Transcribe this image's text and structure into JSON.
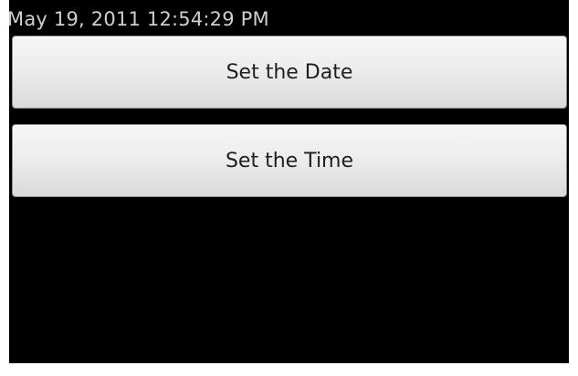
{
  "status": {
    "datetime": "May 19, 2011 12:54:29 PM"
  },
  "buttons": {
    "set_date": "Set the Date",
    "set_time": "Set the Time"
  },
  "colors": {
    "background": "#000000",
    "text_light": "#cfcfcf",
    "button_face": "#ededed",
    "button_text": "#202020"
  }
}
